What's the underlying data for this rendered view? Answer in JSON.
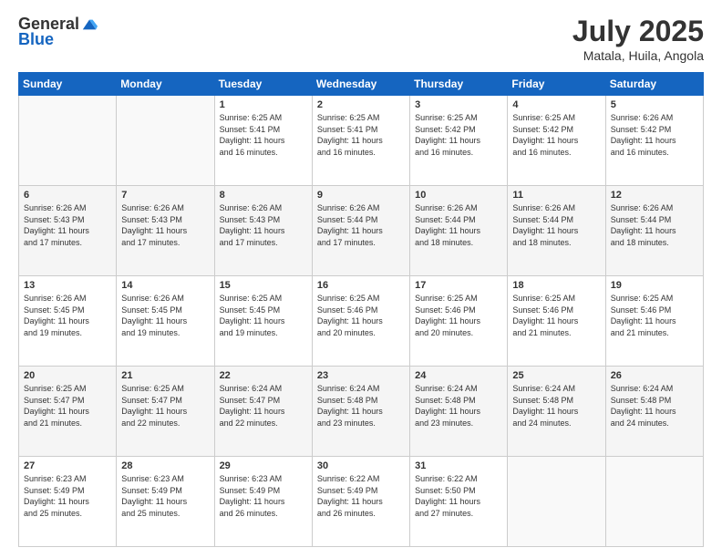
{
  "header": {
    "logo_general": "General",
    "logo_blue": "Blue",
    "month_year": "July 2025",
    "location": "Matala, Huila, Angola"
  },
  "days_of_week": [
    "Sunday",
    "Monday",
    "Tuesday",
    "Wednesday",
    "Thursday",
    "Friday",
    "Saturday"
  ],
  "weeks": [
    [
      {
        "day": "",
        "info": ""
      },
      {
        "day": "",
        "info": ""
      },
      {
        "day": "1",
        "sunrise": "6:25 AM",
        "sunset": "5:41 PM",
        "daylight": "11 hours and 16 minutes."
      },
      {
        "day": "2",
        "sunrise": "6:25 AM",
        "sunset": "5:41 PM",
        "daylight": "11 hours and 16 minutes."
      },
      {
        "day": "3",
        "sunrise": "6:25 AM",
        "sunset": "5:42 PM",
        "daylight": "11 hours and 16 minutes."
      },
      {
        "day": "4",
        "sunrise": "6:25 AM",
        "sunset": "5:42 PM",
        "daylight": "11 hours and 16 minutes."
      },
      {
        "day": "5",
        "sunrise": "6:26 AM",
        "sunset": "5:42 PM",
        "daylight": "11 hours and 16 minutes."
      }
    ],
    [
      {
        "day": "6",
        "sunrise": "6:26 AM",
        "sunset": "5:43 PM",
        "daylight": "11 hours and 17 minutes."
      },
      {
        "day": "7",
        "sunrise": "6:26 AM",
        "sunset": "5:43 PM",
        "daylight": "11 hours and 17 minutes."
      },
      {
        "day": "8",
        "sunrise": "6:26 AM",
        "sunset": "5:43 PM",
        "daylight": "11 hours and 17 minutes."
      },
      {
        "day": "9",
        "sunrise": "6:26 AM",
        "sunset": "5:44 PM",
        "daylight": "11 hours and 17 minutes."
      },
      {
        "day": "10",
        "sunrise": "6:26 AM",
        "sunset": "5:44 PM",
        "daylight": "11 hours and 18 minutes."
      },
      {
        "day": "11",
        "sunrise": "6:26 AM",
        "sunset": "5:44 PM",
        "daylight": "11 hours and 18 minutes."
      },
      {
        "day": "12",
        "sunrise": "6:26 AM",
        "sunset": "5:44 PM",
        "daylight": "11 hours and 18 minutes."
      }
    ],
    [
      {
        "day": "13",
        "sunrise": "6:26 AM",
        "sunset": "5:45 PM",
        "daylight": "11 hours and 19 minutes."
      },
      {
        "day": "14",
        "sunrise": "6:26 AM",
        "sunset": "5:45 PM",
        "daylight": "11 hours and 19 minutes."
      },
      {
        "day": "15",
        "sunrise": "6:25 AM",
        "sunset": "5:45 PM",
        "daylight": "11 hours and 19 minutes."
      },
      {
        "day": "16",
        "sunrise": "6:25 AM",
        "sunset": "5:46 PM",
        "daylight": "11 hours and 20 minutes."
      },
      {
        "day": "17",
        "sunrise": "6:25 AM",
        "sunset": "5:46 PM",
        "daylight": "11 hours and 20 minutes."
      },
      {
        "day": "18",
        "sunrise": "6:25 AM",
        "sunset": "5:46 PM",
        "daylight": "11 hours and 21 minutes."
      },
      {
        "day": "19",
        "sunrise": "6:25 AM",
        "sunset": "5:46 PM",
        "daylight": "11 hours and 21 minutes."
      }
    ],
    [
      {
        "day": "20",
        "sunrise": "6:25 AM",
        "sunset": "5:47 PM",
        "daylight": "11 hours and 21 minutes."
      },
      {
        "day": "21",
        "sunrise": "6:25 AM",
        "sunset": "5:47 PM",
        "daylight": "11 hours and 22 minutes."
      },
      {
        "day": "22",
        "sunrise": "6:24 AM",
        "sunset": "5:47 PM",
        "daylight": "11 hours and 22 minutes."
      },
      {
        "day": "23",
        "sunrise": "6:24 AM",
        "sunset": "5:48 PM",
        "daylight": "11 hours and 23 minutes."
      },
      {
        "day": "24",
        "sunrise": "6:24 AM",
        "sunset": "5:48 PM",
        "daylight": "11 hours and 23 minutes."
      },
      {
        "day": "25",
        "sunrise": "6:24 AM",
        "sunset": "5:48 PM",
        "daylight": "11 hours and 24 minutes."
      },
      {
        "day": "26",
        "sunrise": "6:24 AM",
        "sunset": "5:48 PM",
        "daylight": "11 hours and 24 minutes."
      }
    ],
    [
      {
        "day": "27",
        "sunrise": "6:23 AM",
        "sunset": "5:49 PM",
        "daylight": "11 hours and 25 minutes."
      },
      {
        "day": "28",
        "sunrise": "6:23 AM",
        "sunset": "5:49 PM",
        "daylight": "11 hours and 25 minutes."
      },
      {
        "day": "29",
        "sunrise": "6:23 AM",
        "sunset": "5:49 PM",
        "daylight": "11 hours and 26 minutes."
      },
      {
        "day": "30",
        "sunrise": "6:22 AM",
        "sunset": "5:49 PM",
        "daylight": "11 hours and 26 minutes."
      },
      {
        "day": "31",
        "sunrise": "6:22 AM",
        "sunset": "5:50 PM",
        "daylight": "11 hours and 27 minutes."
      },
      {
        "day": "",
        "info": ""
      },
      {
        "day": "",
        "info": ""
      }
    ]
  ],
  "labels": {
    "sunrise": "Sunrise:",
    "sunset": "Sunset:",
    "daylight": "Daylight:"
  }
}
